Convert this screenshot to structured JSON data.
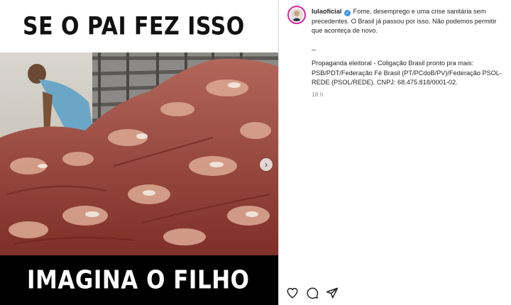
{
  "media": {
    "top_caption": "SE O PAI FEZ ISSO",
    "bottom_caption": "IMAGINA O FILHO",
    "next_icon": "chevron-right-icon"
  },
  "post": {
    "username": "lulaoficial",
    "verified_icon": "verified-badge-icon",
    "caption": "Fome, desemprego e uma crise sanitária sem precedentes. O Brasil já passou por isso. Não podemos permitir que aconteça de novo.",
    "separator": "_",
    "ad_text": "Propaganda eleitoral - Coligação Brasil pronto pra mais: PSB/PDT/Federação Fé Brasil (PT/PCdoB/PV)/Federação PSOL-REDE (PSOL/REDE). CNPJ: 68.475.818/0001-02.",
    "time": "18 h"
  },
  "actions": {
    "like_icon": "heart-icon",
    "comment_icon": "comment-icon",
    "share_icon": "share-icon"
  },
  "colors": {
    "verified": "#3897f0",
    "avatar_ring": "#d6249f",
    "muted_text": "#8e8e8e"
  }
}
